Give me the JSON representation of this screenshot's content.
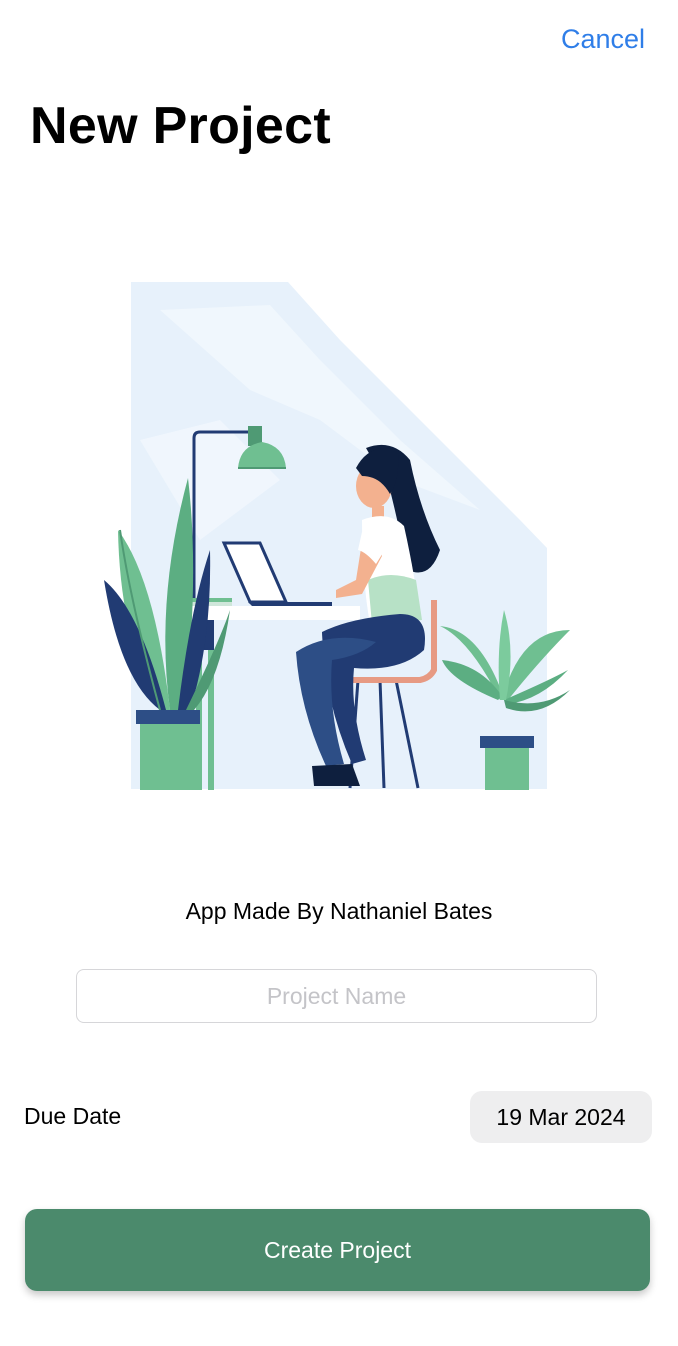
{
  "header": {
    "cancel_label": "Cancel",
    "title": "New Project"
  },
  "credit_text": "App Made By Nathaniel Bates",
  "project_name": {
    "value": "",
    "placeholder": "Project Name"
  },
  "due_date": {
    "label": "Due Date",
    "value": "19 Mar 2024"
  },
  "create_button_label": "Create Project",
  "colors": {
    "accent": "#2f7ee8",
    "primary_button": "#4b8a6c",
    "date_pill_bg": "#eeeeef",
    "illustration_bg": "#e7f1fb",
    "plant_green": "#6fbf91",
    "navy": "#213b73"
  },
  "illustration": {
    "subject": "woman-working-at-laptop-desk-illustration"
  }
}
